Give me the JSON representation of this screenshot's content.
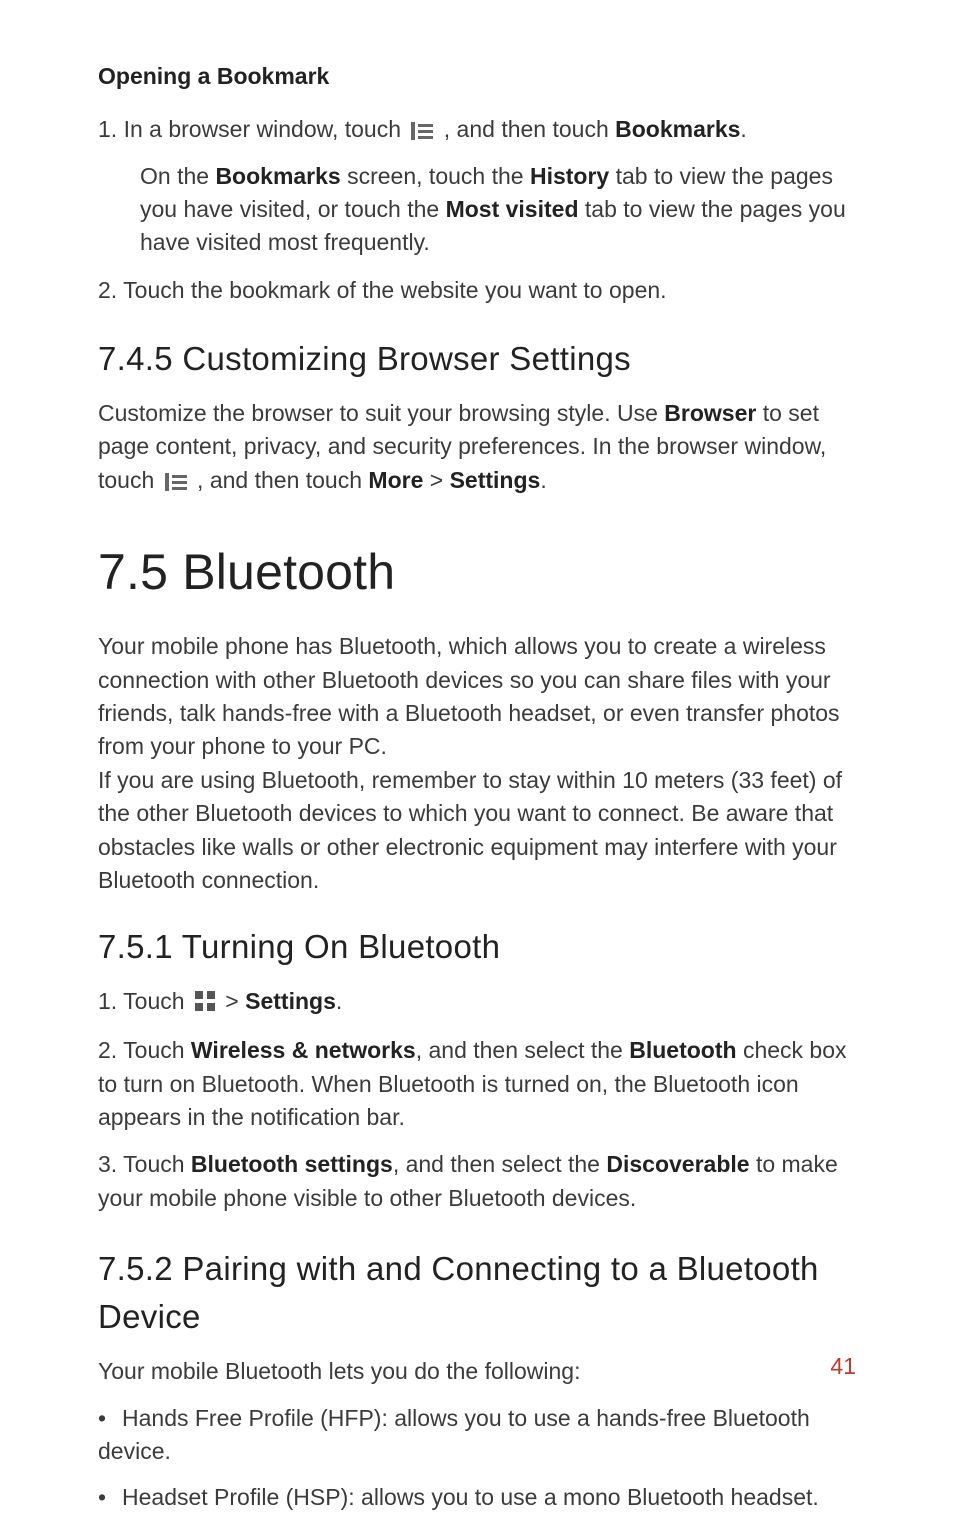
{
  "h_open_bookmark": "Opening a Bookmark",
  "step1_a": "1. In a browser window, touch ",
  "step1_b": " , and then touch ",
  "step1_bold": "Bookmarks",
  "step1_c": ".",
  "step1_detail_a": "On the ",
  "step1_detail_b": "Bookmarks",
  "step1_detail_c": " screen, touch the ",
  "step1_detail_d": "History",
  "step1_detail_e": " tab to view the pages you have visited, or touch the ",
  "step1_detail_f": "Most visited",
  "step1_detail_g": " tab to view the pages you have visited most frequently.",
  "step2": "2. Touch the bookmark of the website you want to open.",
  "h745": "7.4.5  Customizing Browser Settings",
  "p745_a": "Customize the browser to suit your browsing style. Use ",
  "p745_b": "Browser",
  "p745_c": " to set page content, privacy, and security preferences. In the browser window, touch ",
  "p745_d": " , and then touch ",
  "p745_e": "More",
  "p745_f": " > ",
  "p745_g": "Settings",
  "p745_h": ".",
  "h75": "7.5  Bluetooth",
  "p75": "Your mobile phone has Bluetooth, which allows you to create a wireless connection with other Bluetooth devices so you can share files with your friends, talk hands-free with a Bluetooth headset, or even transfer photos from your phone to your PC.\nIf you are using Bluetooth, remember to stay within 10 meters (33 feet) of the other Bluetooth devices to which you want to connect. Be aware that obstacles like walls or other electronic equipment may interfere with your Bluetooth connection.",
  "h751": "7.5.1  Turning On Bluetooth",
  "s751_1a": "1. Touch ",
  "s751_1b": "  > ",
  "s751_1c": "Settings",
  "s751_1d": ".",
  "s751_2a": "2. Touch ",
  "s751_2b": "Wireless & networks",
  "s751_2c": ", and then select the ",
  "s751_2d": "Bluetooth",
  "s751_2e": " check box to turn on Bluetooth. When Bluetooth is turned on, the Bluetooth icon appears in the notification bar.",
  "s751_3a": "3. Touch ",
  "s751_3b": "Bluetooth settings",
  "s751_3c": ", and then select the ",
  "s751_3d": "Discoverable",
  "s751_3e": " to make your mobile phone visible to other Bluetooth devices.",
  "h752": "7.5.2  Pairing with and Connecting to a Bluetooth Device",
  "p752": "Your mobile Bluetooth lets you do the following:",
  "b1": "Hands Free Profile (HFP): allows you to use a hands-free Bluetooth device.",
  "b2": "Headset Profile (HSP): allows you to use a mono Bluetooth headset.",
  "page": "41"
}
